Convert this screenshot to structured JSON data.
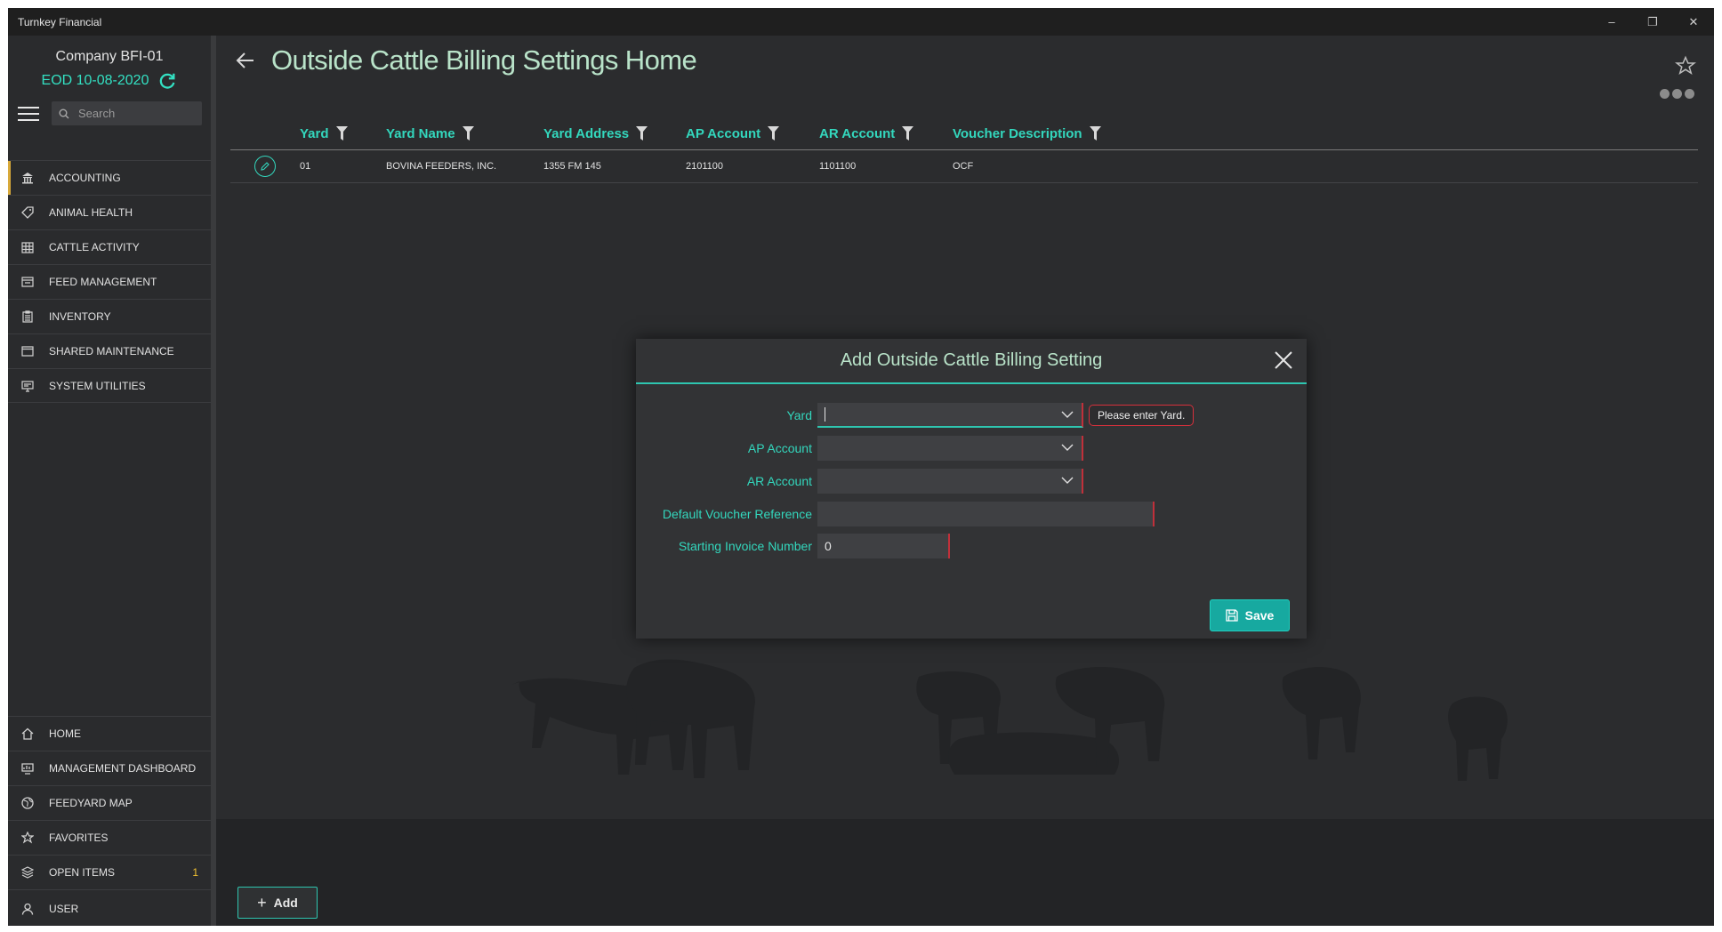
{
  "window": {
    "title": "Turnkey Financial",
    "controls": [
      "–",
      "❐",
      "✕"
    ]
  },
  "sidebar": {
    "company": "Company BFI-01",
    "eod": "EOD 10-08-2020",
    "search_placeholder": "Search",
    "top_items": [
      {
        "label": "ACCOUNTING",
        "icon": "bank-icon"
      },
      {
        "label": "ANIMAL HEALTH",
        "icon": "tag-icon"
      },
      {
        "label": "CATTLE ACTIVITY",
        "icon": "grid-icon"
      },
      {
        "label": "FEED MANAGEMENT",
        "icon": "feed-icon"
      },
      {
        "label": "INVENTORY",
        "icon": "clipboard-icon"
      },
      {
        "label": "SHARED MAINTENANCE",
        "icon": "window-icon"
      },
      {
        "label": "SYSTEM UTILITIES",
        "icon": "monitor-icon"
      }
    ],
    "bottom_items": [
      {
        "label": "HOME",
        "icon": "home-icon"
      },
      {
        "label": "MANAGEMENT DASHBOARD",
        "icon": "dashboard-icon"
      },
      {
        "label": "FEEDYARD MAP",
        "icon": "globe-icon"
      },
      {
        "label": "FAVORITES",
        "icon": "star-icon"
      },
      {
        "label": "OPEN ITEMS",
        "icon": "layers-icon",
        "badge": "1"
      },
      {
        "label": "USER",
        "icon": "user-icon"
      }
    ]
  },
  "page": {
    "title": "Outside Cattle Billing Settings Home"
  },
  "grid": {
    "columns": [
      "Yard",
      "Yard Name",
      "Yard Address",
      "AP Account",
      "AR Account",
      "Voucher Description"
    ],
    "rows": [
      [
        "01",
        "BOVINA FEEDERS, INC.",
        "1355 FM 145",
        "2101100",
        "1101100",
        "OCF"
      ]
    ]
  },
  "add_button": "Add",
  "modal": {
    "title": "Add Outside Cattle Billing Setting",
    "fields": {
      "yard_label": "Yard",
      "yard_value": "",
      "yard_error": "Please enter Yard.",
      "ap_label": "AP Account",
      "ap_value": "",
      "ar_label": "AR Account",
      "ar_value": "",
      "voucher_label": "Default Voucher Reference",
      "voucher_value": "",
      "invoice_label": "Starting Invoice Number",
      "invoice_value": "0"
    },
    "save_label": "Save"
  },
  "colors": {
    "accent": "#33d7bd",
    "title": "#b9e3c9",
    "error": "#d6303c",
    "eod": "#33e0c2",
    "badge": "#f0c030"
  }
}
